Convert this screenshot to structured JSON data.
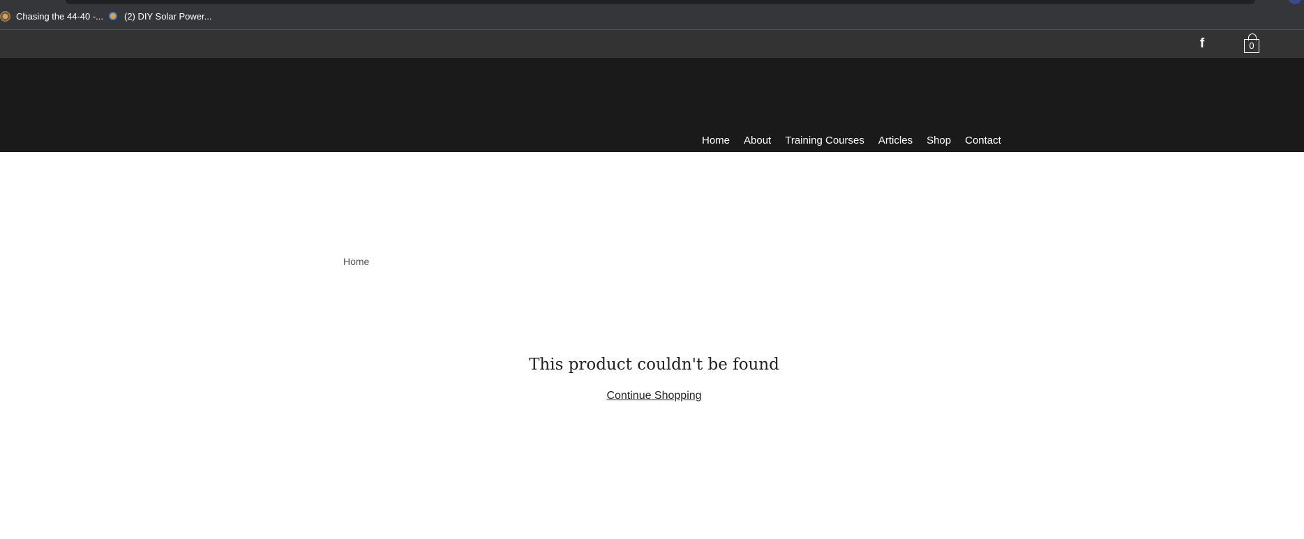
{
  "browser": {
    "bookmarks": [
      {
        "label": "Chasing the 44-40 -...",
        "icon": "site-favicon-round"
      },
      {
        "label": "(2) DIY Solar Power...",
        "icon": "sun-favicon"
      }
    ]
  },
  "topbar": {
    "social_icon": "facebook-icon",
    "cart_icon": "shopping-bag-icon",
    "cart_count": "0"
  },
  "nav": {
    "items": [
      "Home",
      "About",
      "Training Courses",
      "Articles",
      "Shop",
      "Contact"
    ]
  },
  "breadcrumb": {
    "label": "Home"
  },
  "main": {
    "message": "This product couldn't be found",
    "continue_label": "Continue Shopping"
  },
  "colors": {
    "topbar": "#333333",
    "header": "#1a1a1a",
    "background": "#ffffff",
    "text": "#222222"
  }
}
